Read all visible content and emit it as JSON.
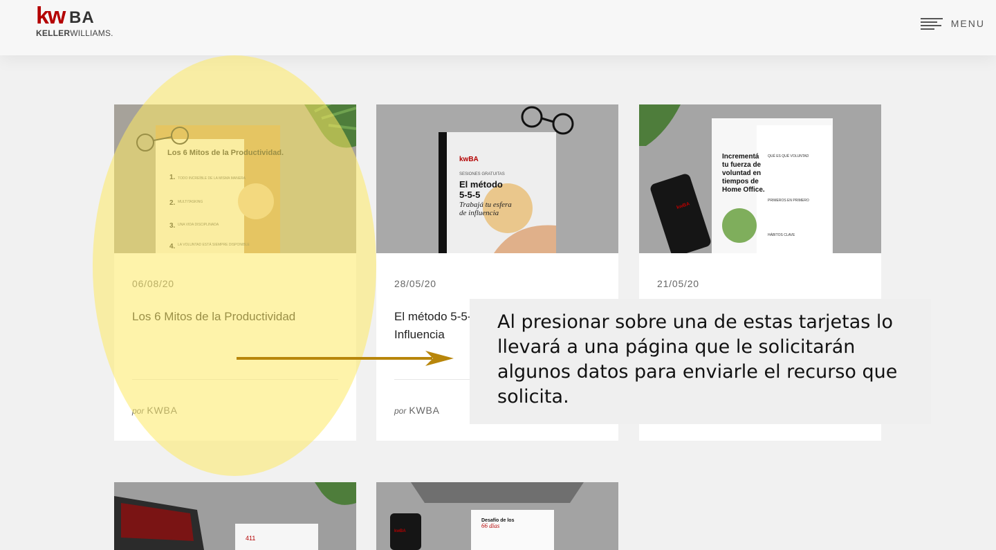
{
  "header": {
    "logo": {
      "mark": "kw",
      "suffix": "BA",
      "brand_first": "KELLER",
      "brand_second": "WILLIAMS."
    },
    "menu_label": "MENU",
    "menu_icon": "hamburger-icon"
  },
  "cards": [
    {
      "date": "06/08/20",
      "title": "Los 6 Mitos de la Productividad",
      "author_prefix": "por",
      "author": "KWBA",
      "thumb": {
        "heading": "Los 6 Mitos de la Productividad.",
        "items": [
          {
            "num": "1.",
            "label": "TODO INCREÍBLE DE LA MISMA MANERA"
          },
          {
            "num": "2.",
            "label": "MULTITASKING"
          },
          {
            "num": "3.",
            "label": "UNA VIDA DISCIPLINADA"
          },
          {
            "num": "4.",
            "label": "LA VOLUNTAD ESTÁ SIEMPRE DISPONIBLE"
          }
        ]
      }
    },
    {
      "date": "28/05/20",
      "title": "El método 5-5-5: Trabajá tu esfera de Influencia",
      "author_prefix": "por",
      "author": "KWBA",
      "thumb": {
        "logo": "kwBA",
        "kicker": "SESIONES GRATUITAS",
        "heading_line1": "El método",
        "heading_line2": "5-5-5",
        "subheading_line1": "Trabajá tu esfera",
        "subheading_line2": "de influencia"
      }
    },
    {
      "date": "21/05/20",
      "title": "",
      "author_prefix": "",
      "author": "",
      "thumb": {
        "heading_line1": "Incrementá",
        "heading_line2": "tu fuerza de",
        "heading_line3": "voluntad en",
        "heading_line4": "tiempos de",
        "heading_line5": "Home Office.",
        "phone_logo": "kwBA",
        "side_section1": "QUÉ ES QUÉ VOLUNTAD",
        "side_section2": "PRIMEROS EN PRIMERO",
        "side_section3": "HÁBITOS CLAVE"
      }
    }
  ],
  "small_cards": [
    {
      "thumb_text": "411"
    },
    {
      "heading_line1": "Desafío de los",
      "heading_line2": "66 días",
      "phone_logo": "kwBA"
    }
  ],
  "overlay": {
    "highlight_color": "#fde964",
    "arrow_color": "#b8860b",
    "text": "Al presionar sobre una de estas tarjetas lo llevará a una página que le solicitarán algunos datos para enviarle el recurso que solicita."
  }
}
